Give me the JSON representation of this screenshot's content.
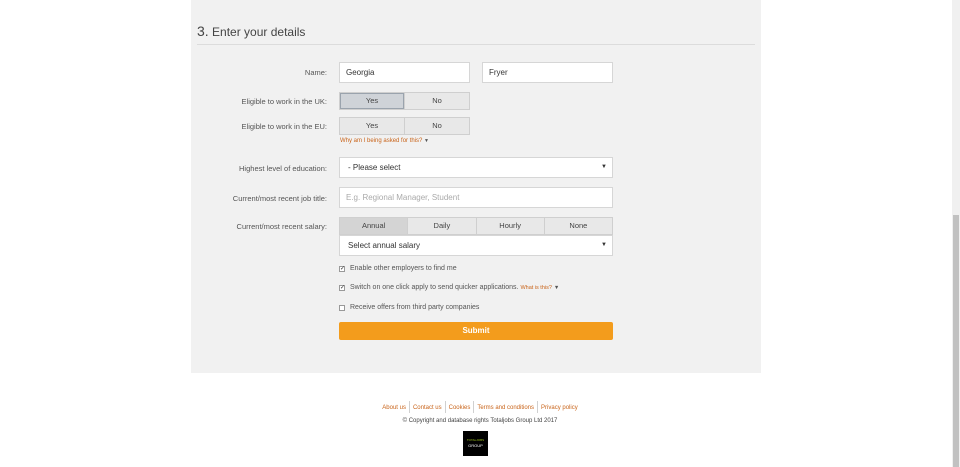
{
  "section": {
    "number": "3.",
    "title": "Enter your details"
  },
  "name": {
    "label": "Name:",
    "first_value": "Georgia",
    "last_value": "Fryer"
  },
  "uk": {
    "label": "Eligible to work in the UK:",
    "yes": "Yes",
    "no": "No",
    "selected": "Yes"
  },
  "eu": {
    "label": "Eligible to work in the EU:",
    "yes": "Yes",
    "no": "No",
    "why": "Why am I being asked for this?"
  },
  "education": {
    "label": "Highest level of education:",
    "value": "- Please select"
  },
  "job": {
    "label": "Current/most recent job title:",
    "placeholder": "E.g. Regional Manager, Student"
  },
  "salary": {
    "label": "Current/most recent salary:",
    "options": [
      "Annual",
      "Daily",
      "Hourly",
      "None"
    ],
    "selected": "Annual",
    "select_value": "Select annual salary"
  },
  "checkboxes": [
    {
      "label": "Enable other employers to find me",
      "checked": true
    },
    {
      "label": "Switch on one click apply to send quicker applications.",
      "link": "What is this?",
      "checked": true
    },
    {
      "label": "Receive offers from third party companies",
      "checked": false
    }
  ],
  "submit_label": "Submit",
  "footer": {
    "links": [
      "About us",
      "Contact us",
      "Cookies",
      "Terms and conditions",
      "Privacy policy"
    ],
    "copyright": "© Copyright and database rights Totaljobs Group Ltd 2017",
    "logo_top": "TOTALJOBS",
    "logo_bottom": "GROUP"
  },
  "colors": {
    "accent": "#f39c1c",
    "link": "#c9641a",
    "panel": "#f1f1f1"
  }
}
